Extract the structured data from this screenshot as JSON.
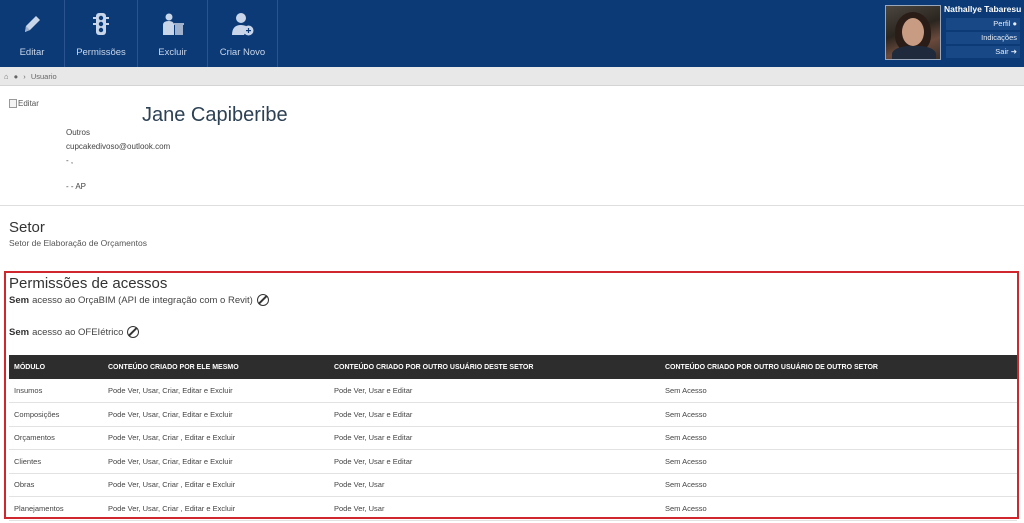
{
  "toolbar": {
    "items": [
      {
        "label": "Editar",
        "icon": "pencil-icon"
      },
      {
        "label": "Permissões",
        "icon": "traffic-light-icon"
      },
      {
        "label": "Excluir",
        "icon": "trash-user-icon"
      },
      {
        "label": "Criar Novo",
        "icon": "add-user-icon"
      }
    ]
  },
  "user": {
    "name": "Nathallye Tabaresu",
    "menu": [
      "Perfil",
      "Indicações",
      "Sair"
    ]
  },
  "breadcrumb": {
    "current": "Usuario"
  },
  "profile": {
    "image_alt": "Editar",
    "name": "Jane Capiberibe",
    "role": "Outros",
    "email": "cupcakedivoso@outlook.com",
    "line3": "- ,",
    "line4": "- - AP"
  },
  "setor": {
    "heading": "Setor",
    "value": "Setor de Elaboração de Orçamentos"
  },
  "permissions": {
    "heading": "Permissões de acessos",
    "access": [
      {
        "bold": "Sem",
        "text": "acesso ao OrçaBIM (API de integração com o Revit)"
      },
      {
        "bold": "Sem",
        "text": "acesso ao OFEIétrico"
      }
    ],
    "columns": [
      "MÓDULO",
      "CONTEÚDO CRIADO POR ELE MESMO",
      "CONTEÚDO CRIADO POR OUTRO USUÁRIO DESTE SETOR",
      "CONTEÚDO CRIADO POR OUTRO USUÁRIO DE OUTRO SETOR"
    ],
    "rows": [
      [
        "Insumos",
        "Pode Ver, Usar, Criar, Editar e Excluir",
        "Pode Ver, Usar e Editar",
        "Sem Acesso"
      ],
      [
        "Composições",
        "Pode Ver, Usar, Criar, Editar e Excluir",
        "Pode Ver, Usar e Editar",
        "Sem Acesso"
      ],
      [
        "Orçamentos",
        "Pode Ver, Usar, Criar , Editar e Excluir",
        "Pode Ver, Usar e Editar",
        "Sem Acesso"
      ],
      [
        "Clientes",
        "Pode Ver, Usar, Criar, Editar e Excluir",
        "Pode Ver, Usar e Editar",
        "Sem Acesso"
      ],
      [
        "Obras",
        "Pode Ver, Usar, Criar , Editar e Excluir",
        "Pode Ver, Usar",
        "Sem Acesso"
      ],
      [
        "Planejamentos",
        "Pode Ver, Usar, Criar , Editar e Excluir",
        "Pode Ver, Usar",
        "Sem Acesso"
      ]
    ]
  },
  "colors": {
    "header": "#0b3a76",
    "highlight": "#d0262e",
    "table_header": "#2d2d2d"
  }
}
